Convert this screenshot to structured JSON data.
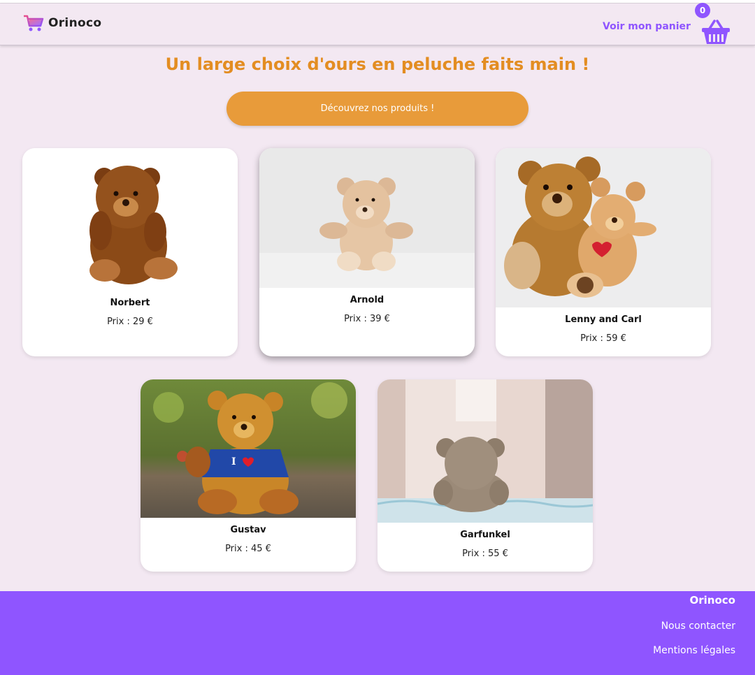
{
  "header": {
    "brand": "Orinoco",
    "cart_link": "Voir mon panier",
    "cart_count": "0",
    "accent_color": "#8f55ff"
  },
  "hero": {
    "title": "Un large choix d'ours en peluche faits main !",
    "cta": "Découvrez nos produits !",
    "title_color": "#e38d22",
    "cta_color": "#e89b3a"
  },
  "products": [
    {
      "name": "Norbert",
      "price": "Prix : 29 €"
    },
    {
      "name": "Arnold",
      "price": "Prix : 39 €"
    },
    {
      "name": "Lenny and Carl",
      "price": "Prix : 59 €"
    },
    {
      "name": "Gustav",
      "price": "Prix : 45 €"
    },
    {
      "name": "Garfunkel",
      "price": "Prix : 55 €"
    }
  ],
  "footer": {
    "brand": "Orinoco",
    "contact": "Nous contacter",
    "legal": "Mentions légales"
  }
}
